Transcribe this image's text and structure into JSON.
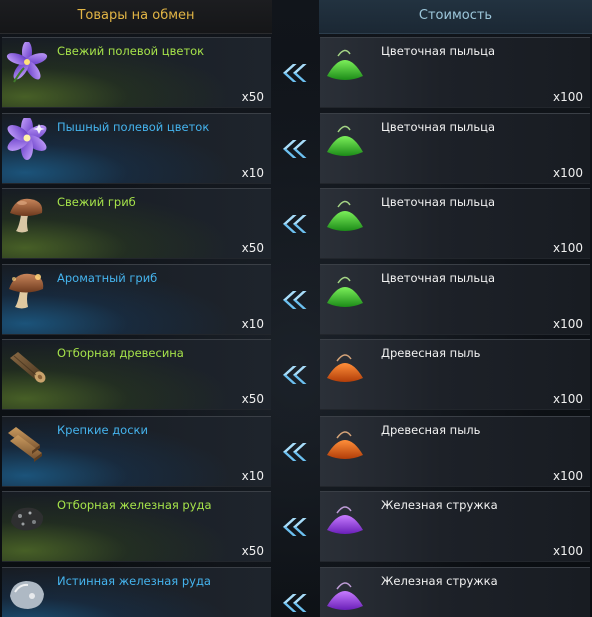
{
  "headers": {
    "exchange_goods": "Товары на обмен",
    "cost": "Стоимость"
  },
  "colors": {
    "header_gold": "#e2b545",
    "header_blue": "#9dc7db",
    "item_green": "#a6e34a",
    "item_blue": "#45b4ee",
    "arrow_blue": "#6cc0f0"
  },
  "rows": [
    {
      "item": {
        "name": "Свежий полевой цветок",
        "qty": "x50",
        "grade": "green",
        "icon": "violet-flower-icon"
      },
      "cost": {
        "name": "Цветочная пыльца",
        "qty": "x100",
        "icon": "green-pollen-icon"
      }
    },
    {
      "item": {
        "name": "Пышный полевой цветок",
        "qty": "x10",
        "grade": "blue",
        "icon": "lush-violet-flower-icon"
      },
      "cost": {
        "name": "Цветочная пыльца",
        "qty": "x100",
        "icon": "green-pollen-icon"
      }
    },
    {
      "item": {
        "name": "Свежий гриб",
        "qty": "x50",
        "grade": "green",
        "icon": "mushroom-icon"
      },
      "cost": {
        "name": "Цветочная пыльца",
        "qty": "x100",
        "icon": "green-pollen-icon"
      }
    },
    {
      "item": {
        "name": "Ароматный гриб",
        "qty": "x10",
        "grade": "blue",
        "icon": "aromatic-mushroom-icon"
      },
      "cost": {
        "name": "Цветочная пыльца",
        "qty": "x100",
        "icon": "green-pollen-icon"
      }
    },
    {
      "item": {
        "name": "Отборная древесина",
        "qty": "x50",
        "grade": "green",
        "icon": "log-icon"
      },
      "cost": {
        "name": "Древесная пыль",
        "qty": "x100",
        "icon": "orange-sawdust-icon"
      }
    },
    {
      "item": {
        "name": "Крепкие доски",
        "qty": "x10",
        "grade": "blue",
        "icon": "planks-icon"
      },
      "cost": {
        "name": "Древесная пыль",
        "qty": "x100",
        "icon": "orange-sawdust-icon"
      }
    },
    {
      "item": {
        "name": "Отборная железная руда",
        "qty": "x50",
        "grade": "green",
        "icon": "iron-ore-icon"
      },
      "cost": {
        "name": "Железная стружка",
        "qty": "x100",
        "icon": "purple-shavings-icon"
      }
    },
    {
      "item": {
        "name": "Истинная железная руда",
        "qty": "",
        "grade": "blue",
        "icon": "pure-iron-ore-icon"
      },
      "cost": {
        "name": "Железная стружка",
        "qty": "",
        "icon": "purple-shavings-icon"
      }
    }
  ]
}
